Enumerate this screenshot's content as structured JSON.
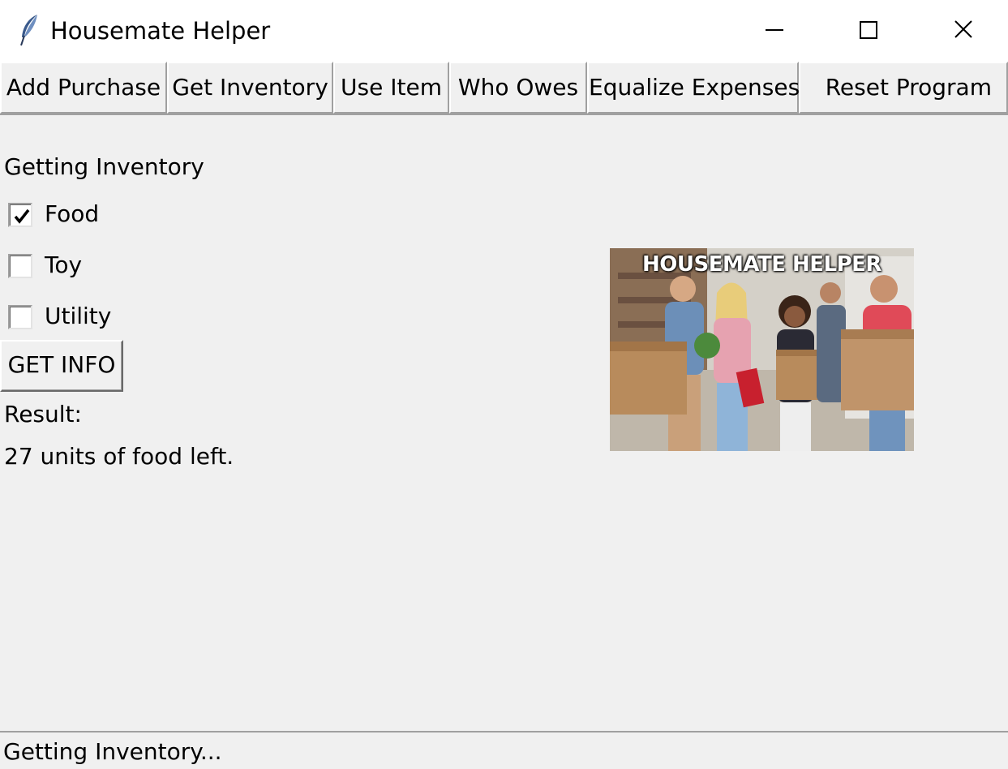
{
  "window": {
    "title": "Housemate Helper"
  },
  "toolbar": {
    "buttons": [
      "Add Purchase",
      "Get Inventory",
      "Use Item",
      "Who Owes",
      "Equalize Expenses",
      "Reset Program"
    ]
  },
  "main": {
    "section_title": "Getting Inventory",
    "checkboxes": [
      {
        "label": "Food",
        "checked": true
      },
      {
        "label": "Toy",
        "checked": false
      },
      {
        "label": "Utility",
        "checked": false
      }
    ],
    "get_info_label": "GET INFO",
    "result_label": "Result:",
    "result_text": "27 units of food left."
  },
  "banner": {
    "title": "HOUSEMATE HELPER"
  },
  "status": {
    "text": "Getting Inventory..."
  },
  "icons": {
    "app": "feather-icon",
    "minimize": "minimize-icon",
    "maximize": "maximize-icon",
    "close": "close-icon",
    "check": "checkmark-icon"
  }
}
